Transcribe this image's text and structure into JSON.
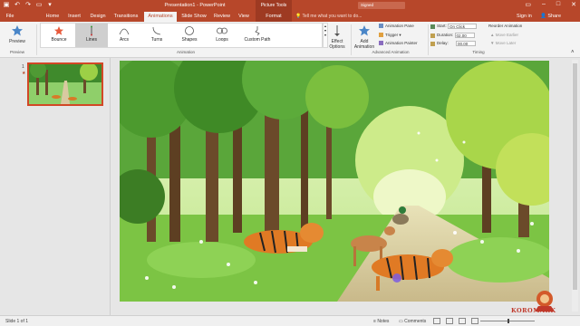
{
  "window": {
    "title": "Presentation1 - PowerPoint",
    "context_group": "Picture Tools",
    "search_placeholder": "Tell me what you want to do...",
    "signin": "Sign in",
    "share": "Share"
  },
  "tabs": [
    {
      "label": "File"
    },
    {
      "label": "Home"
    },
    {
      "label": "Insert"
    },
    {
      "label": "Design"
    },
    {
      "label": "Transitions"
    },
    {
      "label": "Animations",
      "active": true
    },
    {
      "label": "Slide Show"
    },
    {
      "label": "Review"
    },
    {
      "label": "View"
    },
    {
      "label": "Format",
      "contextual": true
    }
  ],
  "ribbon": {
    "preview": {
      "label": "Preview",
      "group": "Preview"
    },
    "gallery": {
      "items": [
        "Bounce",
        "Lines",
        "Arcs",
        "Turns",
        "Shapes",
        "Loops",
        "Custom Path"
      ],
      "selected": "Lines",
      "group": "Animation"
    },
    "effect_options": "Effect Options",
    "add_animation": "Add Animation",
    "advanced": {
      "animation_pane": "Animation Pane",
      "trigger": "Trigger",
      "animation_painter": "Animation Painter",
      "group": "Advanced Animation"
    },
    "timing": {
      "start_label": "Start:",
      "start_value": "On Click",
      "duration_label": "Duration:",
      "duration_value": "02.00",
      "delay_label": "Delay:",
      "delay_value": "00.00",
      "reorder": "Reorder Animation",
      "move_earlier": "Move Earlier",
      "move_later": "Move Later",
      "group": "Timing"
    }
  },
  "thumbnails": {
    "number": "1",
    "star": "★"
  },
  "statusbar": {
    "slide_info": "Slide 1 of 1",
    "notes": "Notes",
    "comments": "Comments"
  },
  "watermark": {
    "text": "KOROMARK"
  },
  "colors": {
    "accent": "#b7472a",
    "ribbon": "#f3f3f3"
  }
}
